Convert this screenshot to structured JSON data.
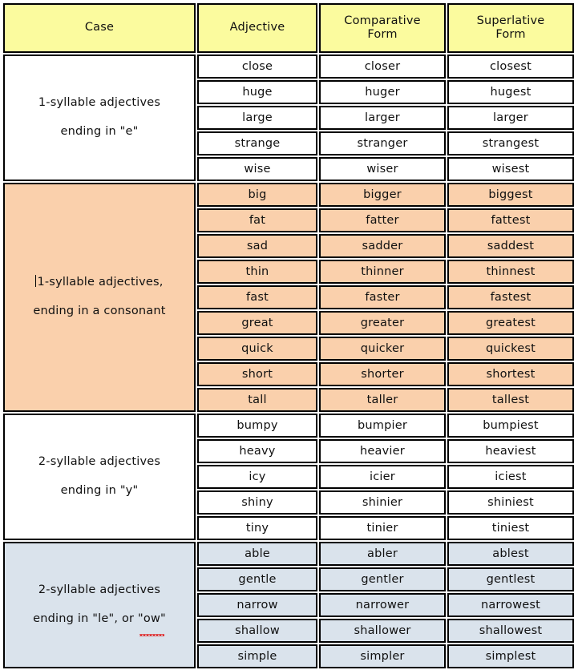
{
  "table": {
    "headers": [
      {
        "label": "Case"
      },
      {
        "label": "Adjective"
      },
      {
        "label_line1": "Comparative",
        "label_line2": "Form"
      },
      {
        "label_line3": "Superlative",
        "label_line4": "Form"
      }
    ],
    "colors": {
      "header_bg": "#FBFB9E",
      "section_white_bg": "#FFFFFF",
      "section_peach_bg": "#FAD0AC",
      "section_blue_bg": "#DAE3EC",
      "border": "#000000",
      "text": "#111111",
      "spellcheck_underline": "#E02020"
    },
    "sections": [
      {
        "case_line1": "1-syllable adjectives",
        "case_line2": "ending in \"e\"",
        "style": "sec-white",
        "has_caret": false,
        "rows": [
          {
            "adjective": "close",
            "comparative": "closer",
            "superlative": "closest"
          },
          {
            "adjective": "huge",
            "comparative": "huger",
            "superlative": "hugest"
          },
          {
            "adjective": "large",
            "comparative": "larger",
            "superlative": "larger"
          },
          {
            "adjective": "strange",
            "comparative": "stranger",
            "superlative": "strangest"
          },
          {
            "adjective": "wise",
            "comparative": "wiser",
            "superlative": "wisest"
          }
        ]
      },
      {
        "case_line1": "1-syllable adjectives,",
        "case_line2": "ending in a consonant",
        "style": "sec-peach",
        "has_caret": true,
        "rows": [
          {
            "adjective": "big",
            "comparative": "bigger",
            "superlative": "biggest"
          },
          {
            "adjective": "fat",
            "comparative": "fatter",
            "superlative": "fattest"
          },
          {
            "adjective": "sad",
            "comparative": "sadder",
            "superlative": "saddest"
          },
          {
            "adjective": "thin",
            "comparative": "thinner",
            "superlative": "thinnest"
          },
          {
            "adjective": "fast",
            "comparative": "faster",
            "superlative": "fastest"
          },
          {
            "adjective": "great",
            "comparative": "greater",
            "superlative": "greatest"
          },
          {
            "adjective": "quick",
            "comparative": "quicker",
            "superlative": "quickest"
          },
          {
            "adjective": "short",
            "comparative": "shorter",
            "superlative": "shortest"
          },
          {
            "adjective": "tall",
            "comparative": "taller",
            "superlative": "tallest"
          }
        ]
      },
      {
        "case_line1": "2-syllable adjectives",
        "case_line2": "ending in \"y\"",
        "style": "sec-white",
        "has_caret": false,
        "rows": [
          {
            "adjective": "bumpy",
            "comparative": "bumpier",
            "superlative": "bumpiest"
          },
          {
            "adjective": "heavy",
            "comparative": "heavier",
            "superlative": "heaviest"
          },
          {
            "adjective": "icy",
            "comparative": "icier",
            "superlative": "iciest"
          },
          {
            "adjective": "shiny",
            "comparative": "shinier",
            "superlative": "shiniest"
          },
          {
            "adjective": "tiny",
            "comparative": "tinier",
            "superlative": "tiniest"
          }
        ]
      },
      {
        "case_line1": "2-syllable adjectives",
        "case_line2_a": "ending in \"le\", or ",
        "case_line2_b": "\"ow\"",
        "style": "sec-blue",
        "has_caret": false,
        "spellcheck_on_line2_b": true,
        "rows": [
          {
            "adjective": "able",
            "comparative": "abler",
            "superlative": "ablest"
          },
          {
            "adjective": "gentle",
            "comparative": "gentler",
            "superlative": "gentlest"
          },
          {
            "adjective": "narrow",
            "comparative": "narrower",
            "superlative": "narrowest"
          },
          {
            "adjective": "shallow",
            "comparative": "shallower",
            "superlative": "shallowest"
          },
          {
            "adjective": "simple",
            "comparative": "simpler",
            "superlative": "simplest"
          }
        ]
      }
    ]
  }
}
